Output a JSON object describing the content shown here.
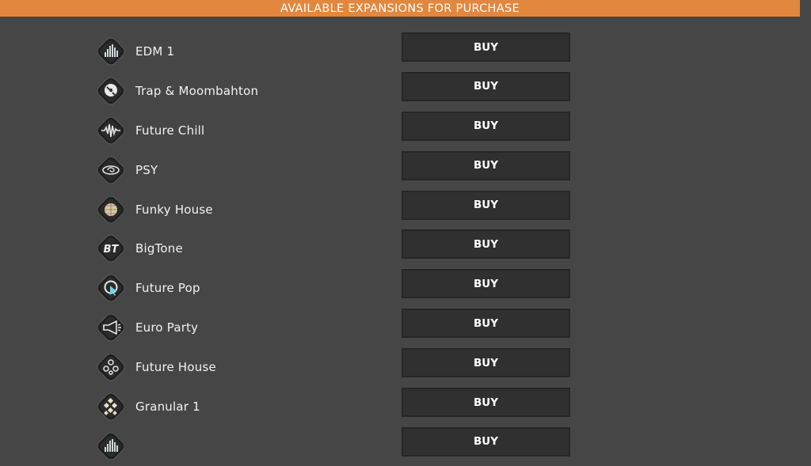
{
  "header": {
    "title": "AVAILABLE EXPANSIONS FOR PURCHASE"
  },
  "buy_label": "BUY",
  "expansions": [
    {
      "name": "EDM 1",
      "icon": "equalizer-bars-icon",
      "accent": "#3fb0a8"
    },
    {
      "name": "Trap & Moombahton",
      "icon": "vinyl-record-icon",
      "accent": "#b8b33a"
    },
    {
      "name": "Future Chill",
      "icon": "sound-wave-icon",
      "accent": "#3cb86a"
    },
    {
      "name": "PSY",
      "icon": "spiral-eye-icon",
      "accent": "#9a4ab8"
    },
    {
      "name": "Funky House",
      "icon": "disco-ball-icon",
      "accent": "#c7a15a"
    },
    {
      "name": "BigTone",
      "icon": "bt-logo-icon",
      "accent": "#b0b0b0"
    },
    {
      "name": "Future Pop",
      "icon": "cursor-ring-icon",
      "accent": "#b03a64"
    },
    {
      "name": "Euro Party",
      "icon": "megaphone-icon",
      "accent": "#3cb84a"
    },
    {
      "name": "Future House",
      "icon": "molecule-icon",
      "accent": "#5a5ac8"
    },
    {
      "name": "Granular 1",
      "icon": "granular-cubes-icon",
      "accent": "#c8a03c"
    },
    {
      "name": "",
      "icon": "equalizer-bars-icon",
      "accent": "#7a7a7a"
    }
  ]
}
